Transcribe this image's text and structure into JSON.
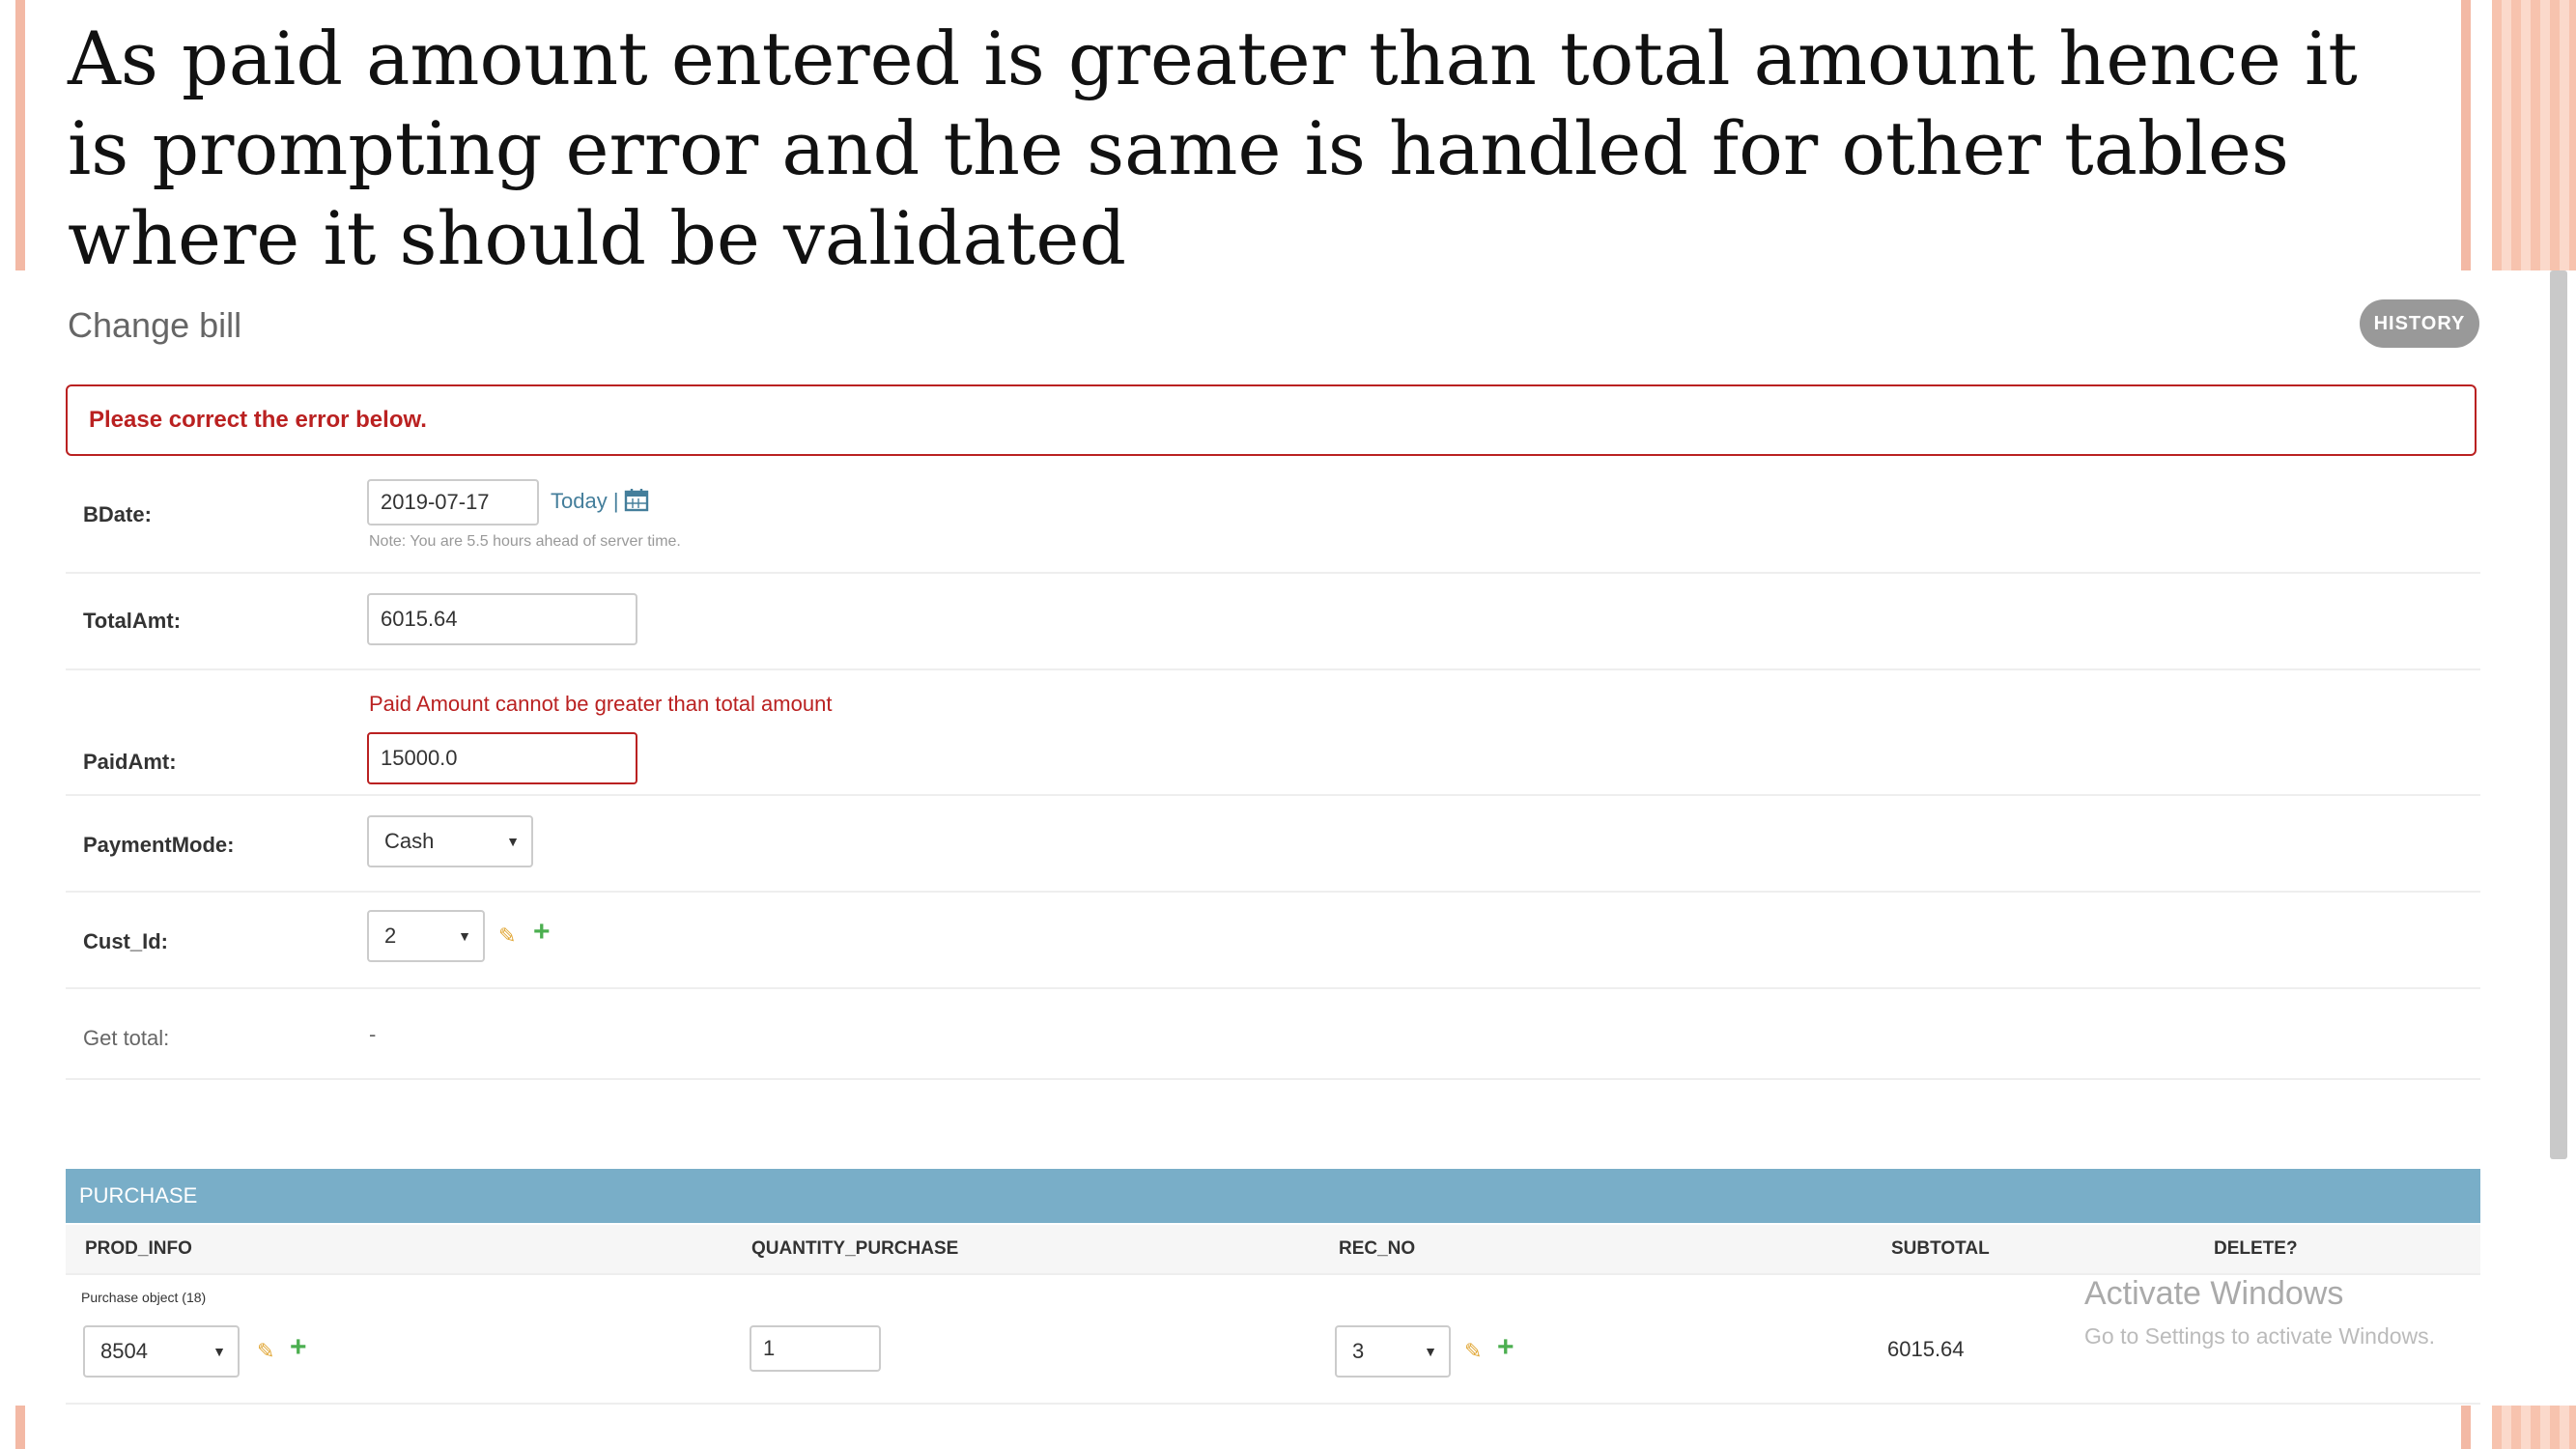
{
  "slide": {
    "title": "As paid amount entered is greater than total amount hence it is prompting error and the same is handled for other tables where it should be validated"
  },
  "page": {
    "heading": "Change bill",
    "history_button": "HISTORY",
    "error_note": "Please correct the error below."
  },
  "form": {
    "bdate": {
      "label": "BDate:",
      "value": "2019-07-17",
      "today_link": "Today |",
      "calendar_icon": "calendar-icon",
      "note": "Note: You are 5.5 hours ahead of server time."
    },
    "totalamt": {
      "label": "TotalAmt:",
      "value": "6015.64"
    },
    "paidamt": {
      "label": "PaidAmt:",
      "value": "15000.0",
      "error": "Paid Amount cannot be greater than total amount"
    },
    "paymentmode": {
      "label": "PaymentMode:",
      "selected": "Cash"
    },
    "cust_id": {
      "label": "Cust_Id:",
      "selected": "2",
      "edit_icon": "pencil-icon",
      "add_icon": "plus-icon"
    },
    "get_total": {
      "label": "Get total:",
      "value": "-"
    }
  },
  "purchase": {
    "header": "PURCHASE",
    "columns": [
      "PROD_INFO",
      "QUANTITY_PURCHASE",
      "REC_NO",
      "SUBTOTAL",
      "DELETE?"
    ],
    "object_label": "Purchase object (18)",
    "row": {
      "prod_info": "8504",
      "quantity": "1",
      "rec_no": "3",
      "subtotal": "6015.64"
    }
  },
  "watermark": {
    "line1": "Activate Windows",
    "line2": "Go to Settings to activate Windows."
  },
  "colors": {
    "error": "#ba2121",
    "inline_header": "#79aec8",
    "link": "#447e9b",
    "accent_deco": "#f3b9a5"
  }
}
